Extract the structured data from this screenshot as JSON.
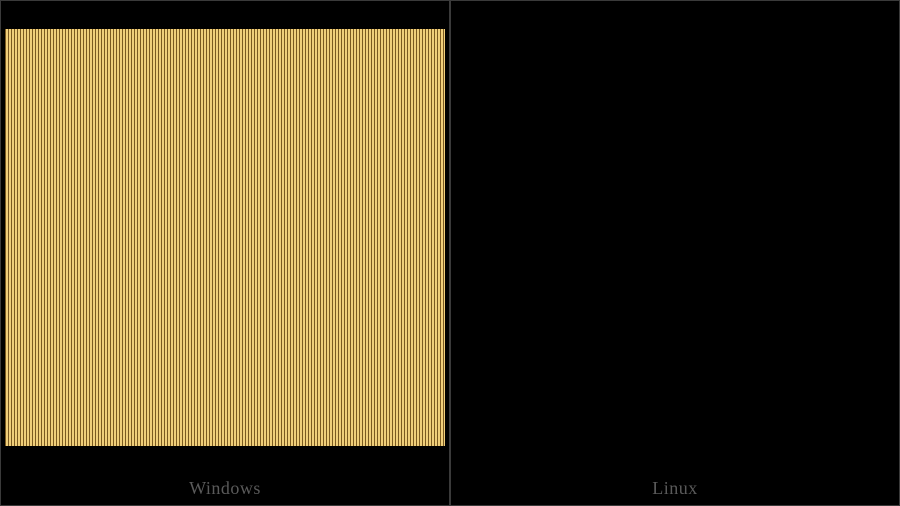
{
  "panels": {
    "left": {
      "caption": "Windows"
    },
    "right": {
      "caption": "Linux"
    }
  }
}
